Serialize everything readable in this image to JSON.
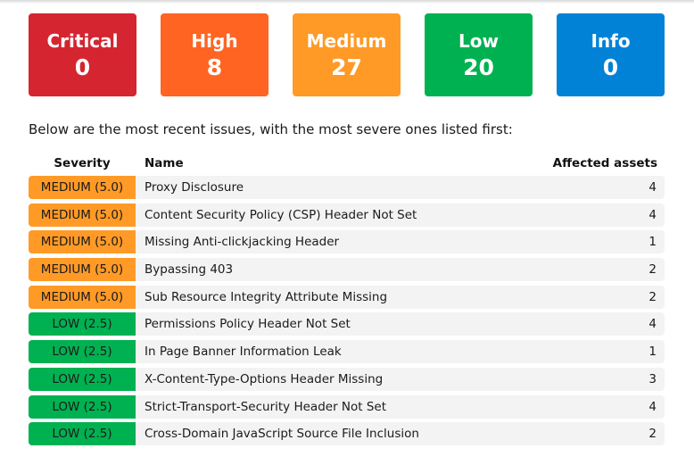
{
  "summary": {
    "cards": [
      {
        "label": "Critical",
        "count": "0",
        "color": "#d52530"
      },
      {
        "label": "High",
        "count": "8",
        "color": "#ff6422"
      },
      {
        "label": "Medium",
        "count": "27",
        "color": "#ff9a27"
      },
      {
        "label": "Low",
        "count": "20",
        "color": "#00b151"
      },
      {
        "label": "Info",
        "count": "0",
        "color": "#0282d6"
      }
    ]
  },
  "intro_text": "Below are the most recent issues, with the most severe ones listed first:",
  "table": {
    "headers": {
      "severity": "Severity",
      "name": "Name",
      "assets": "Affected assets"
    },
    "severity_colors": {
      "medium": "#ff9a27",
      "low": "#00b151"
    },
    "rows": [
      {
        "severity": "MEDIUM (5.0)",
        "level": "medium",
        "name": "Proxy Disclosure",
        "assets": "4"
      },
      {
        "severity": "MEDIUM (5.0)",
        "level": "medium",
        "name": "Content Security Policy (CSP) Header Not Set",
        "assets": "4"
      },
      {
        "severity": "MEDIUM (5.0)",
        "level": "medium",
        "name": "Missing Anti-clickjacking Header",
        "assets": "1"
      },
      {
        "severity": "MEDIUM (5.0)",
        "level": "medium",
        "name": "Bypassing 403",
        "assets": "2"
      },
      {
        "severity": "MEDIUM (5.0)",
        "level": "medium",
        "name": "Sub Resource Integrity Attribute Missing",
        "assets": "2"
      },
      {
        "severity": "LOW (2.5)",
        "level": "low",
        "name": "Permissions Policy Header Not Set",
        "assets": "4"
      },
      {
        "severity": "LOW (2.5)",
        "level": "low",
        "name": "In Page Banner Information Leak",
        "assets": "1"
      },
      {
        "severity": "LOW (2.5)",
        "level": "low",
        "name": "X-Content-Type-Options Header Missing",
        "assets": "3"
      },
      {
        "severity": "LOW (2.5)",
        "level": "low",
        "name": "Strict-Transport-Security Header Not Set",
        "assets": "4"
      },
      {
        "severity": "LOW (2.5)",
        "level": "low",
        "name": "Cross-Domain JavaScript Source File Inclusion",
        "assets": "2"
      }
    ]
  }
}
